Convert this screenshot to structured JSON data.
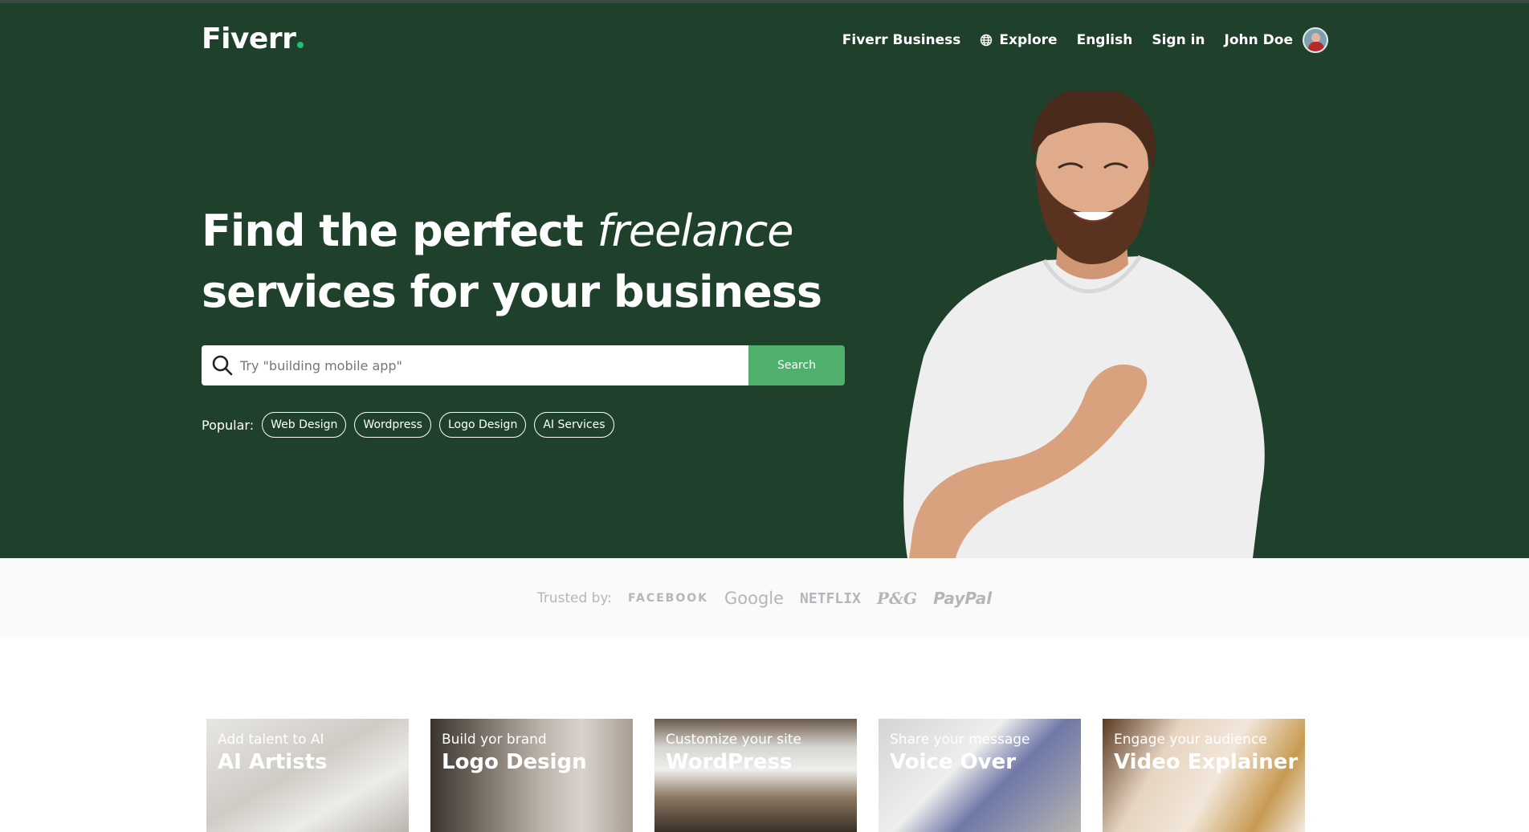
{
  "nav": {
    "logo": "Fiverr",
    "links": {
      "business": "Fiverr Business",
      "explore": "Explore",
      "language": "English",
      "signin": "Sign in",
      "user": "John Doe"
    }
  },
  "hero": {
    "line1_bold": "Find the perfect",
    "line1_italic": "freelance",
    "line2": "services for your business",
    "search_placeholder": "Try \"building mobile app\"",
    "search_button": "Search",
    "popular_label": "Popular:",
    "popular": [
      "Web Design",
      "Wordpress",
      "Logo Design",
      "AI Services"
    ]
  },
  "trusted": {
    "label": "Trusted by:",
    "brands": [
      "FACEBOOK",
      "Google",
      "NETFLIX",
      "P&G",
      "PayPal"
    ]
  },
  "categories": [
    {
      "subtitle": "Add talent to AI",
      "title": "AI Artists"
    },
    {
      "subtitle": "Build yor brand",
      "title": "Logo Design"
    },
    {
      "subtitle": "Customize your site",
      "title": "WordPress"
    },
    {
      "subtitle": "Share your message",
      "title": "Voice Over"
    },
    {
      "subtitle": "Engage your audience",
      "title": "Video Explainer"
    }
  ],
  "colors": {
    "hero_bg": "#1f412b",
    "accent": "#1dbf73",
    "search_button": "#4fb06d"
  }
}
